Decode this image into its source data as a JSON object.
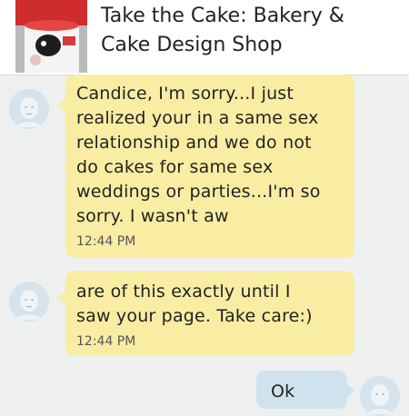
{
  "header": {
    "title": "Take the Cake: Bakery &\nCake Design Shop"
  },
  "messages": [
    {
      "text": "Candice, I'm sorry...I just\nrealized your in a same sex\nrelationship  and we do not\ndo cakes for same sex\nweddings or parties...I'm so\nsorry. I wasn't aw",
      "time": "12:44 PM"
    },
    {
      "text": "are of this exactly until I\nsaw your page. Take care:)",
      "time": "12:44 PM"
    },
    {
      "text": "Ok"
    }
  ],
  "colors": {
    "incoming_bubble": "#f8eda3",
    "outgoing_bubble": "#cfe3ee",
    "avatar_bg": "#d5e3ec"
  },
  "icons": {
    "shop_avatar": "cake-photo-icon",
    "user_avatar": "default-user-icon"
  }
}
